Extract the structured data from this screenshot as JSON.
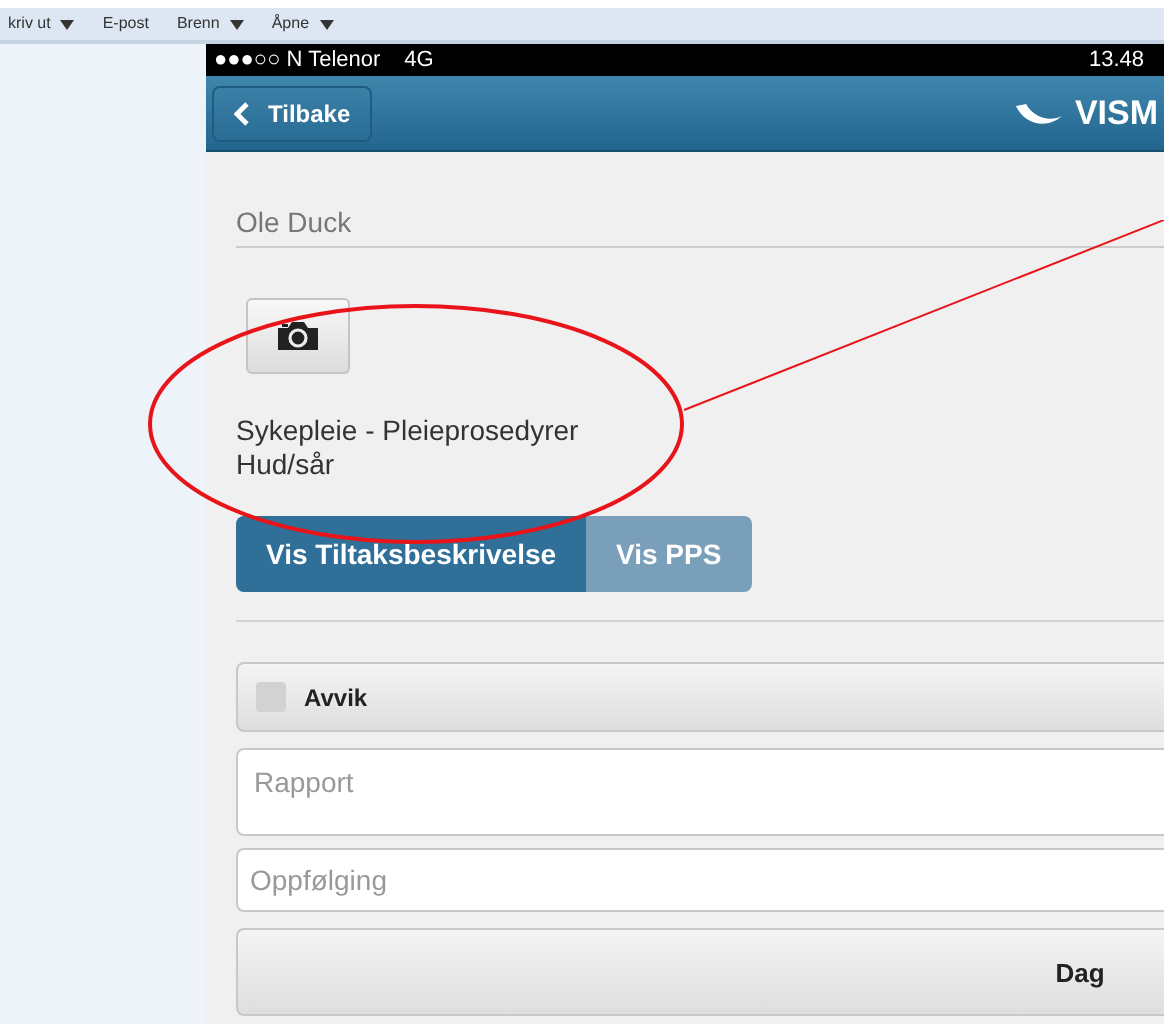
{
  "toolbar": [
    {
      "label": "kriv ut",
      "dropdown": true
    },
    {
      "label": "E-post",
      "dropdown": false
    },
    {
      "label": "Brenn",
      "dropdown": true
    },
    {
      "label": "Åpne",
      "dropdown": true
    }
  ],
  "status_bar": {
    "carrier": "●●●○○ N Telenor",
    "network": "4G",
    "time": "13.48"
  },
  "nav_bar": {
    "back": "Tilbake",
    "logo": "VISM"
  },
  "patient": "Ole Duck",
  "task": [
    "Sykepleie - Pleieprosedyrer",
    "Hud/sår"
  ],
  "segments": [
    {
      "label": "Vis Tiltaksbeskrivelse",
      "selected": true
    },
    {
      "label": "Vis PPS",
      "selected": false
    }
  ],
  "deviation": {
    "label": "Avvik",
    "checked": false
  },
  "report": {
    "placeholder": "Rapport"
  },
  "followup": {
    "placeholder": "Oppfølging"
  },
  "shift_button": "Dag"
}
